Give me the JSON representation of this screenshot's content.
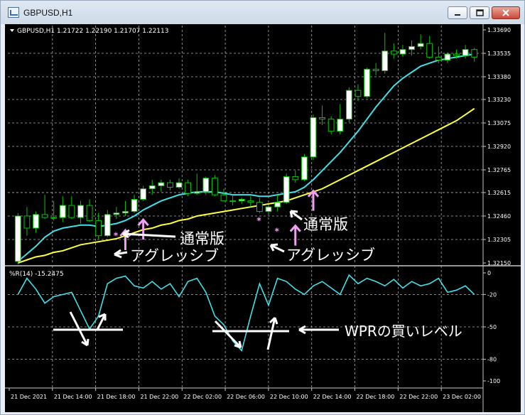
{
  "window": {
    "title": "GBPUSD,H1",
    "buttons": {
      "minimize": "minimize-icon",
      "restore": "restore-icon",
      "close": "close-icon"
    }
  },
  "chart": {
    "header": "GBPUSD,H1  1.21722 1.22190 1.21707 1.22113",
    "price_axis": [
      "1.33690",
      "1.33535",
      "1.33380",
      "1.33230",
      "1.33075",
      "1.32920",
      "1.32765",
      "1.32615",
      "1.32460",
      "1.32305",
      "1.32150"
    ],
    "indicator_header": "%R(14) -15.2475",
    "indicator_axis": [
      "0",
      "-20",
      "-50",
      "-80",
      "-100"
    ],
    "time_axis": [
      "21 Dec 2021",
      "21 Dec 14:00",
      "21 Dec 18:00",
      "21 Dec 22:00",
      "22 Dec 02:00",
      "22 Dec 06:00",
      "22 Dec 10:00",
      "22 Dec 14:00",
      "22 Dec 18:00",
      "22 Dec 22:00",
      "23 Dec 02:00"
    ],
    "annotations": {
      "normal_1": "通常版",
      "aggressive_1": "アグレッシブ",
      "normal_2": "通常版",
      "aggressive_2": "アグレッシブ",
      "wpr_level": "WPRの買いレベル"
    },
    "colors": {
      "background": "#000000",
      "bull_candle": "#ffffff",
      "bear_candle": "#000000",
      "candle_outline": "#00c800",
      "ma_fast": "#40e0e8",
      "ma_slow": "#ffff40",
      "wpr_line": "#40e0e8",
      "arrows": "#f0a0f0",
      "annotation_text": "#ffffff",
      "grid": "#b0b0b0"
    }
  },
  "chart_data": {
    "type": "candlestick",
    "title": "GBPUSD,H1",
    "ylim": [
      1.3215,
      1.3369
    ],
    "candles": [
      {
        "o": 1.3216,
        "h": 1.3248,
        "l": 1.3214,
        "c": 1.3246
      },
      {
        "o": 1.3246,
        "h": 1.3252,
        "l": 1.3233,
        "c": 1.3238
      },
      {
        "o": 1.3238,
        "h": 1.3249,
        "l": 1.3235,
        "c": 1.3247
      },
      {
        "o": 1.3247,
        "h": 1.326,
        "l": 1.3244,
        "c": 1.3245
      },
      {
        "o": 1.3245,
        "h": 1.3256,
        "l": 1.3243,
        "c": 1.3245
      },
      {
        "o": 1.3245,
        "h": 1.3259,
        "l": 1.3242,
        "c": 1.3253
      },
      {
        "o": 1.3253,
        "h": 1.3259,
        "l": 1.3244,
        "c": 1.3245
      },
      {
        "o": 1.3245,
        "h": 1.3256,
        "l": 1.3241,
        "c": 1.3253
      },
      {
        "o": 1.3253,
        "h": 1.3257,
        "l": 1.3242,
        "c": 1.3243
      },
      {
        "o": 1.3243,
        "h": 1.3248,
        "l": 1.3231,
        "c": 1.3233
      },
      {
        "o": 1.3233,
        "h": 1.325,
        "l": 1.3232,
        "c": 1.3247
      },
      {
        "o": 1.3247,
        "h": 1.3252,
        "l": 1.3244,
        "c": 1.3248
      },
      {
        "o": 1.3248,
        "h": 1.3256,
        "l": 1.3246,
        "c": 1.3249
      },
      {
        "o": 1.3249,
        "h": 1.326,
        "l": 1.3248,
        "c": 1.3257
      },
      {
        "o": 1.3257,
        "h": 1.3266,
        "l": 1.3256,
        "c": 1.3264
      },
      {
        "o": 1.3264,
        "h": 1.327,
        "l": 1.326,
        "c": 1.3266
      },
      {
        "o": 1.3266,
        "h": 1.327,
        "l": 1.3262,
        "c": 1.3268
      },
      {
        "o": 1.3268,
        "h": 1.327,
        "l": 1.3263,
        "c": 1.3265
      },
      {
        "o": 1.3265,
        "h": 1.3271,
        "l": 1.3264,
        "c": 1.3268
      },
      {
        "o": 1.3268,
        "h": 1.327,
        "l": 1.3259,
        "c": 1.3261
      },
      {
        "o": 1.3261,
        "h": 1.3274,
        "l": 1.326,
        "c": 1.3262
      },
      {
        "o": 1.3262,
        "h": 1.3272,
        "l": 1.326,
        "c": 1.3271
      },
      {
        "o": 1.3271,
        "h": 1.3273,
        "l": 1.3259,
        "c": 1.326
      },
      {
        "o": 1.326,
        "h": 1.3264,
        "l": 1.3256,
        "c": 1.3256
      },
      {
        "o": 1.3256,
        "h": 1.326,
        "l": 1.3253,
        "c": 1.3256
      },
      {
        "o": 1.3256,
        "h": 1.3258,
        "l": 1.3254,
        "c": 1.3257
      },
      {
        "o": 1.3256,
        "h": 1.3259,
        "l": 1.3252,
        "c": 1.3255
      },
      {
        "o": 1.3255,
        "h": 1.3258,
        "l": 1.3248,
        "c": 1.3249
      },
      {
        "o": 1.3249,
        "h": 1.3253,
        "l": 1.3247,
        "c": 1.3252
      },
      {
        "o": 1.3252,
        "h": 1.326,
        "l": 1.3249,
        "c": 1.3255
      },
      {
        "o": 1.3255,
        "h": 1.3274,
        "l": 1.3254,
        "c": 1.3272
      },
      {
        "o": 1.3272,
        "h": 1.3276,
        "l": 1.3268,
        "c": 1.327
      },
      {
        "o": 1.327,
        "h": 1.3287,
        "l": 1.3269,
        "c": 1.3285
      },
      {
        "o": 1.3285,
        "h": 1.3313,
        "l": 1.3283,
        "c": 1.3311
      },
      {
        "o": 1.3311,
        "h": 1.3319,
        "l": 1.3306,
        "c": 1.331
      },
      {
        "o": 1.331,
        "h": 1.3312,
        "l": 1.33,
        "c": 1.3302
      },
      {
        "o": 1.3302,
        "h": 1.332,
        "l": 1.33,
        "c": 1.331
      },
      {
        "o": 1.331,
        "h": 1.3331,
        "l": 1.3308,
        "c": 1.3329
      },
      {
        "o": 1.3329,
        "h": 1.3333,
        "l": 1.3322,
        "c": 1.3325
      },
      {
        "o": 1.3325,
        "h": 1.3344,
        "l": 1.3324,
        "c": 1.3343
      },
      {
        "o": 1.3343,
        "h": 1.3347,
        "l": 1.3339,
        "c": 1.3342
      },
      {
        "o": 1.3342,
        "h": 1.3367,
        "l": 1.334,
        "c": 1.3355
      },
      {
        "o": 1.3355,
        "h": 1.336,
        "l": 1.335,
        "c": 1.3353
      },
      {
        "o": 1.3353,
        "h": 1.3359,
        "l": 1.3351,
        "c": 1.3356
      },
      {
        "o": 1.3356,
        "h": 1.3362,
        "l": 1.3352,
        "c": 1.3358
      },
      {
        "o": 1.3358,
        "h": 1.3366,
        "l": 1.3356,
        "c": 1.336
      },
      {
        "o": 1.336,
        "h": 1.3365,
        "l": 1.335,
        "c": 1.3351
      },
      {
        "o": 1.3351,
        "h": 1.3358,
        "l": 1.3347,
        "c": 1.3349
      },
      {
        "o": 1.3349,
        "h": 1.3354,
        "l": 1.3347,
        "c": 1.3353
      },
      {
        "o": 1.3353,
        "h": 1.3356,
        "l": 1.335,
        "c": 1.3352
      },
      {
        "o": 1.3352,
        "h": 1.3359,
        "l": 1.335,
        "c": 1.3356
      },
      {
        "o": 1.3356,
        "h": 1.3357,
        "l": 1.3348,
        "c": 1.3351
      }
    ],
    "series": [
      {
        "values": [
          1.3216,
          1.3221,
          1.3226,
          1.3232,
          1.3236,
          1.3238,
          1.3239,
          1.324,
          1.324,
          1.3239,
          1.324,
          1.3241,
          1.3243,
          1.3246,
          1.325,
          1.3253,
          1.3256,
          1.3258,
          1.326,
          1.3261,
          1.3262,
          1.3262,
          1.3262,
          1.3261,
          1.326,
          1.326,
          1.326,
          1.3259,
          1.3259,
          1.326,
          1.3261,
          1.3262,
          1.3265,
          1.327,
          1.3276,
          1.3282,
          1.3288,
          1.3295,
          1.3302,
          1.331,
          1.3318,
          1.3325,
          1.3332,
          1.3337,
          1.3341,
          1.3345,
          1.3347,
          1.3349,
          1.335,
          1.3351,
          1.3352,
          1.3353
        ]
      },
      {
        "values": [
          1.3215,
          1.3217,
          1.3219,
          1.322,
          1.3222,
          1.3223,
          1.3225,
          1.3227,
          1.3228,
          1.3229,
          1.323,
          1.3231,
          1.3233,
          1.3235,
          1.3237,
          1.3238,
          1.324,
          1.3241,
          1.3243,
          1.3244,
          1.3246,
          1.3247,
          1.3248,
          1.3249,
          1.325,
          1.3251,
          1.3252,
          1.3253,
          1.3254,
          1.3255,
          1.3256,
          1.3258,
          1.326,
          1.3262,
          1.3264,
          1.3267,
          1.327,
          1.3273,
          1.3276,
          1.3279,
          1.3282,
          1.3285,
          1.3288,
          1.3291,
          1.3294,
          1.3297,
          1.33,
          1.3303,
          1.3306,
          1.3309,
          1.3313,
          1.3317
        ]
      }
    ],
    "signals": {
      "stars": [
        {
          "index": 11,
          "price": 1.3233
        },
        {
          "index": 12,
          "price": 1.3233
        },
        {
          "index": 27,
          "price": 1.3243
        },
        {
          "index": 29,
          "price": 1.3236
        }
      ],
      "arrows": [
        {
          "index": 12,
          "price": 1.323
        },
        {
          "index": 14,
          "price": 1.3237
        },
        {
          "index": 31,
          "price": 1.3233
        },
        {
          "index": 33,
          "price": 1.3256
        }
      ]
    },
    "wpr": {
      "ylim": [
        -100,
        0
      ],
      "values": [
        -20,
        -5,
        -15,
        -28,
        -22,
        -20,
        -18,
        -35,
        -52,
        -40,
        -10,
        -5,
        -3,
        -12,
        -14,
        -8,
        -15,
        -10,
        -22,
        -8,
        -5,
        -18,
        -40,
        -48,
        -63,
        -72,
        -40,
        -10,
        -30,
        -5,
        -8,
        -15,
        -20,
        -12,
        -8,
        -14,
        -20,
        -2,
        -10,
        -5,
        -8,
        -12,
        -6,
        -14,
        -8,
        -12,
        -10,
        -5,
        -18,
        -16,
        -12,
        -20
      ],
      "buy_level": -50
    }
  }
}
